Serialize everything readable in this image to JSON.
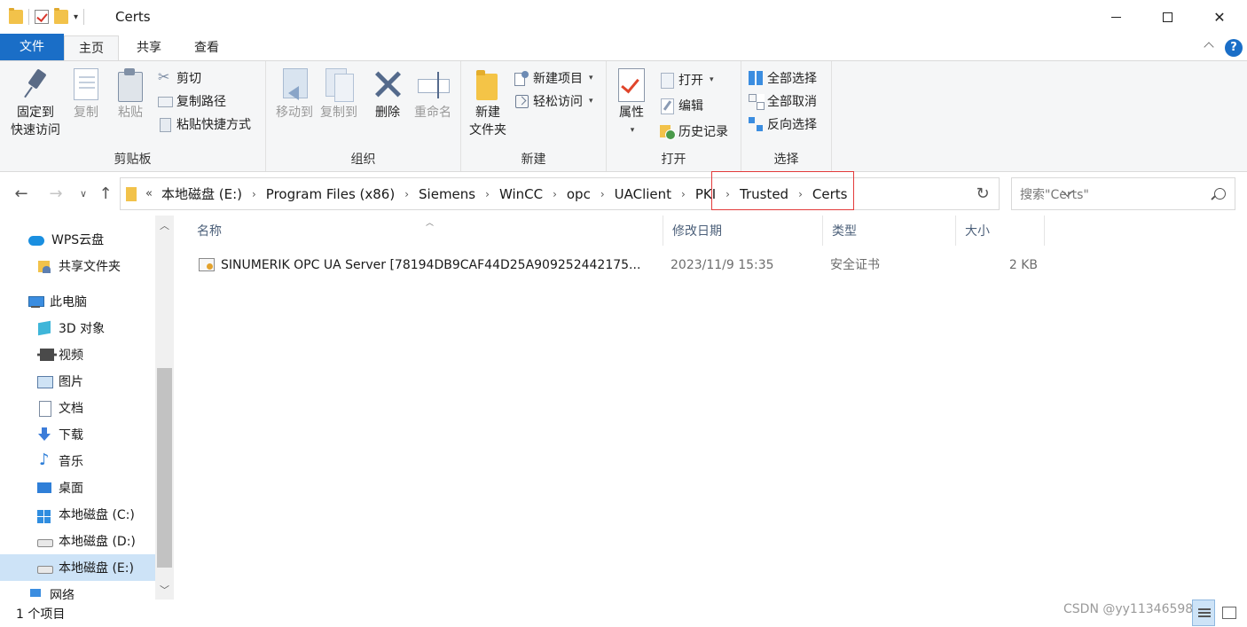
{
  "window": {
    "title": "Certs"
  },
  "ribbon_tabs": {
    "file": "文件",
    "home": "主页",
    "share": "共享",
    "view": "查看"
  },
  "ribbon": {
    "clipboard": {
      "group_label": "剪贴板",
      "pin_label_1": "固定到",
      "pin_label_2": "快速访问",
      "copy": "复制",
      "paste": "粘贴",
      "cut": "剪切",
      "copy_path": "复制路径",
      "paste_shortcut": "粘贴快捷方式"
    },
    "organize": {
      "group_label": "组织",
      "move_to": "移动到",
      "copy_to": "复制到",
      "delete": "删除",
      "rename": "重命名"
    },
    "new": {
      "group_label": "新建",
      "new_folder_1": "新建",
      "new_folder_2": "文件夹",
      "new_item": "新建项目",
      "easy_access": "轻松访问"
    },
    "open": {
      "group_label": "打开",
      "properties": "属性",
      "open": "打开",
      "edit": "编辑",
      "history": "历史记录"
    },
    "select": {
      "group_label": "选择",
      "select_all": "全部选择",
      "select_none": "全部取消",
      "invert": "反向选择"
    }
  },
  "address_bar": {
    "more": "«",
    "crumbs": [
      "本地磁盘 (E:)",
      "Program Files (x86)",
      "Siemens",
      "WinCC",
      "opc",
      "UAClient",
      "PKI",
      "Trusted",
      "Certs"
    ],
    "separator": "›"
  },
  "search": {
    "placeholder": "搜索\"Certs\""
  },
  "nav_pane": {
    "items": [
      {
        "label": "WPS云盘",
        "icon": "cloud-icon"
      },
      {
        "label": "共享文件夹",
        "icon": "shared-folder-icon"
      },
      {
        "label": "此电脑",
        "icon": "pc-icon"
      },
      {
        "label": "3D 对象",
        "icon": "cube-icon"
      },
      {
        "label": "视频",
        "icon": "video-icon"
      },
      {
        "label": "图片",
        "icon": "pictures-icon"
      },
      {
        "label": "文档",
        "icon": "documents-icon"
      },
      {
        "label": "下载",
        "icon": "download-icon"
      },
      {
        "label": "音乐",
        "icon": "music-icon"
      },
      {
        "label": "桌面",
        "icon": "desktop-icon"
      },
      {
        "label": "本地磁盘 (C:)",
        "icon": "windows-drive-icon"
      },
      {
        "label": "本地磁盘 (D:)",
        "icon": "drive-icon"
      },
      {
        "label": "本地磁盘 (E:)",
        "icon": "drive-icon"
      },
      {
        "label": "网络",
        "icon": "network-icon"
      }
    ]
  },
  "file_list": {
    "columns": [
      "名称",
      "修改日期",
      "类型",
      "大小"
    ],
    "rows": [
      {
        "name": "SINUMERIK OPC UA Server [78194DB9CAF44D25A909252442175...",
        "modified": "2023/11/9 15:35",
        "type": "安全证书",
        "size": "2 KB"
      }
    ]
  },
  "status_bar": {
    "count": "1 个项目",
    "watermark": "CSDN @yy1134659804"
  },
  "colors": {
    "accent": "#1a6ec7",
    "selection": "#cde3f7",
    "highlight_box": "#e33b3b"
  }
}
